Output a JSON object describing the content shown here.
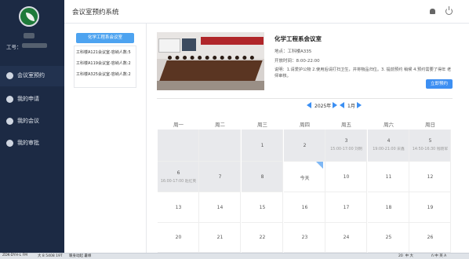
{
  "app": {
    "title": "会议室预约系统",
    "user_label": "工号："
  },
  "sidebar": {
    "items": [
      {
        "label": "会议室预约",
        "active": true
      },
      {
        "label": "我的申请"
      },
      {
        "label": "我的会议"
      },
      {
        "label": "我的审批"
      }
    ]
  },
  "rooms": {
    "selected": "化学工程系会议室",
    "list": [
      "工科楼A121会议室-容纳人数:5",
      "工科楼A119会议室-容纳人数:2",
      "工科楼A325会议室-容纳人数:2"
    ]
  },
  "room_detail": {
    "name": "化学工程系会议室",
    "location": "地点：工科楼A335",
    "hours": "开放时间：8:00-22:00",
    "note": "说明：1.请爱护公物 2.使用后请打扫卫生，并将物品归位。3. 提前预约 稍候 4.预约需要了得年 老师审核。",
    "book_label": "立即预约"
  },
  "calendar": {
    "year": "2025年",
    "month": "1月",
    "weekdays": [
      "周一",
      "周二",
      "周三",
      "周四",
      "周五",
      "周六",
      "周日"
    ],
    "rows": [
      [
        {
          "d": ""
        },
        {
          "d": ""
        },
        {
          "d": "1"
        },
        {
          "d": "2"
        },
        {
          "d": "3",
          "e": "15:00-17:00 刘明"
        },
        {
          "d": "4",
          "e": "19:00-21:00 宋鑫"
        },
        {
          "d": "5",
          "e": "14:50-16:30 钱晓军"
        }
      ],
      [
        {
          "d": "6",
          "e": "16:00-17:00 赵红英"
        },
        {
          "d": "7"
        },
        {
          "d": "8"
        },
        {
          "d": "今天"
        },
        {
          "d": "10"
        },
        {
          "d": "11"
        },
        {
          "d": "12"
        }
      ],
      [
        {
          "d": "13"
        },
        {
          "d": "14"
        },
        {
          "d": "15"
        },
        {
          "d": "16"
        },
        {
          "d": "17"
        },
        {
          "d": "18"
        },
        {
          "d": "19"
        }
      ],
      [
        {
          "d": "20"
        },
        {
          "d": "21"
        },
        {
          "d": "22"
        },
        {
          "d": "23"
        },
        {
          "d": "24"
        },
        {
          "d": "25"
        },
        {
          "d": "26"
        }
      ]
    ]
  },
  "taskbar": {
    "left": "ZDK-DYH-L FM",
    "mid1": "大 8 5408 19T",
    "mid2": "暖身动起 暑缘",
    "right1": "20  中 大",
    "right2": "ñ 中 英 A"
  }
}
